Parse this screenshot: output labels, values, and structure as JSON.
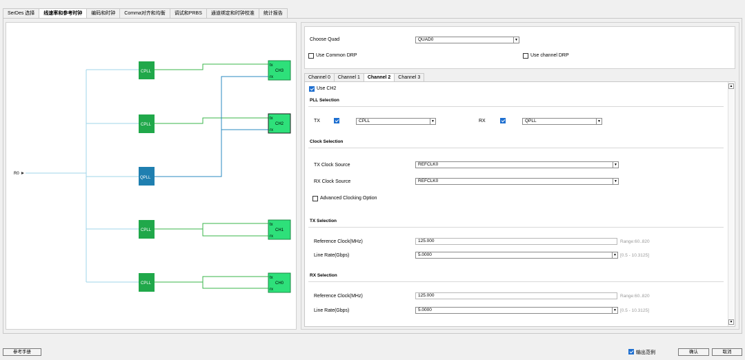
{
  "tabs": [
    "SerDes 选择",
    "线速率和参考时钟",
    "编码和时钟",
    "Comma对齐和均衡",
    "调试和PRBS",
    "通道绑定和时钟校准",
    "统计报告"
  ],
  "diagram": {
    "ref_label": "R0",
    "pll_labels": [
      "CPLL",
      "CPLL",
      "QPLL",
      "CPLL",
      "CPLL"
    ],
    "channels": [
      {
        "name": "CH3",
        "tx": "tx",
        "rx": "rx"
      },
      {
        "name": "CH2",
        "tx": "tx",
        "rx": "rx"
      },
      {
        "name": "CH1",
        "tx": "tx",
        "rx": "rx"
      },
      {
        "name": "CH0",
        "tx": "tx",
        "rx": "rx"
      }
    ],
    "colors": {
      "cpll": "#20a84a",
      "qpll": "#1f7fb0",
      "channel": "#2ee07a",
      "line_green": "#39b54a",
      "line_blue": "#2a8ac0",
      "line_light": "#9fd4ea"
    }
  },
  "quad": {
    "label": "Choose Quad",
    "value": "QUAD0",
    "common_drp": "Use Common DRP",
    "channel_drp": "Use channel DRP"
  },
  "channel_tabs": [
    "Channel 0",
    "Channel 1",
    "Channel 2",
    "Channel 3"
  ],
  "channel": {
    "use_ch": "Use CH2",
    "pll_section": "PLL Selection",
    "tx_label": "TX",
    "tx_pll": "CPLL",
    "rx_label": "RX",
    "rx_pll": "QPLL",
    "clock_section": "Clock Selection",
    "tx_clock_label": "TX Clock Source",
    "tx_clock_value": "REFCLK0",
    "rx_clock_label": "RX Clock Source",
    "rx_clock_value": "REFCLK0",
    "advanced": "Advanced Clocking Option",
    "tx_section": "TX Selection",
    "tx_ref_label": "Reference Clock(MHz)",
    "tx_ref_value": "125.000",
    "tx_ref_range": "Range:60..820",
    "tx_rate_label": "Line Rate(Gbps)",
    "tx_rate_value": "5.0000",
    "tx_rate_range": "[0.5 - 10.3125]",
    "rx_section": "RX Selection",
    "rx_ref_label": "Reference Clock(MHz)",
    "rx_ref_value": "125.000",
    "rx_ref_range": "Range:60..820",
    "rx_rate_label": "Line Rate(Gbps)",
    "rx_rate_value": "5.0000",
    "rx_rate_range": "[0.5 - 10.3125]"
  },
  "footer": {
    "manual": "参考手册",
    "output_example": "输出范例",
    "ok": "确认",
    "cancel": "取消"
  }
}
